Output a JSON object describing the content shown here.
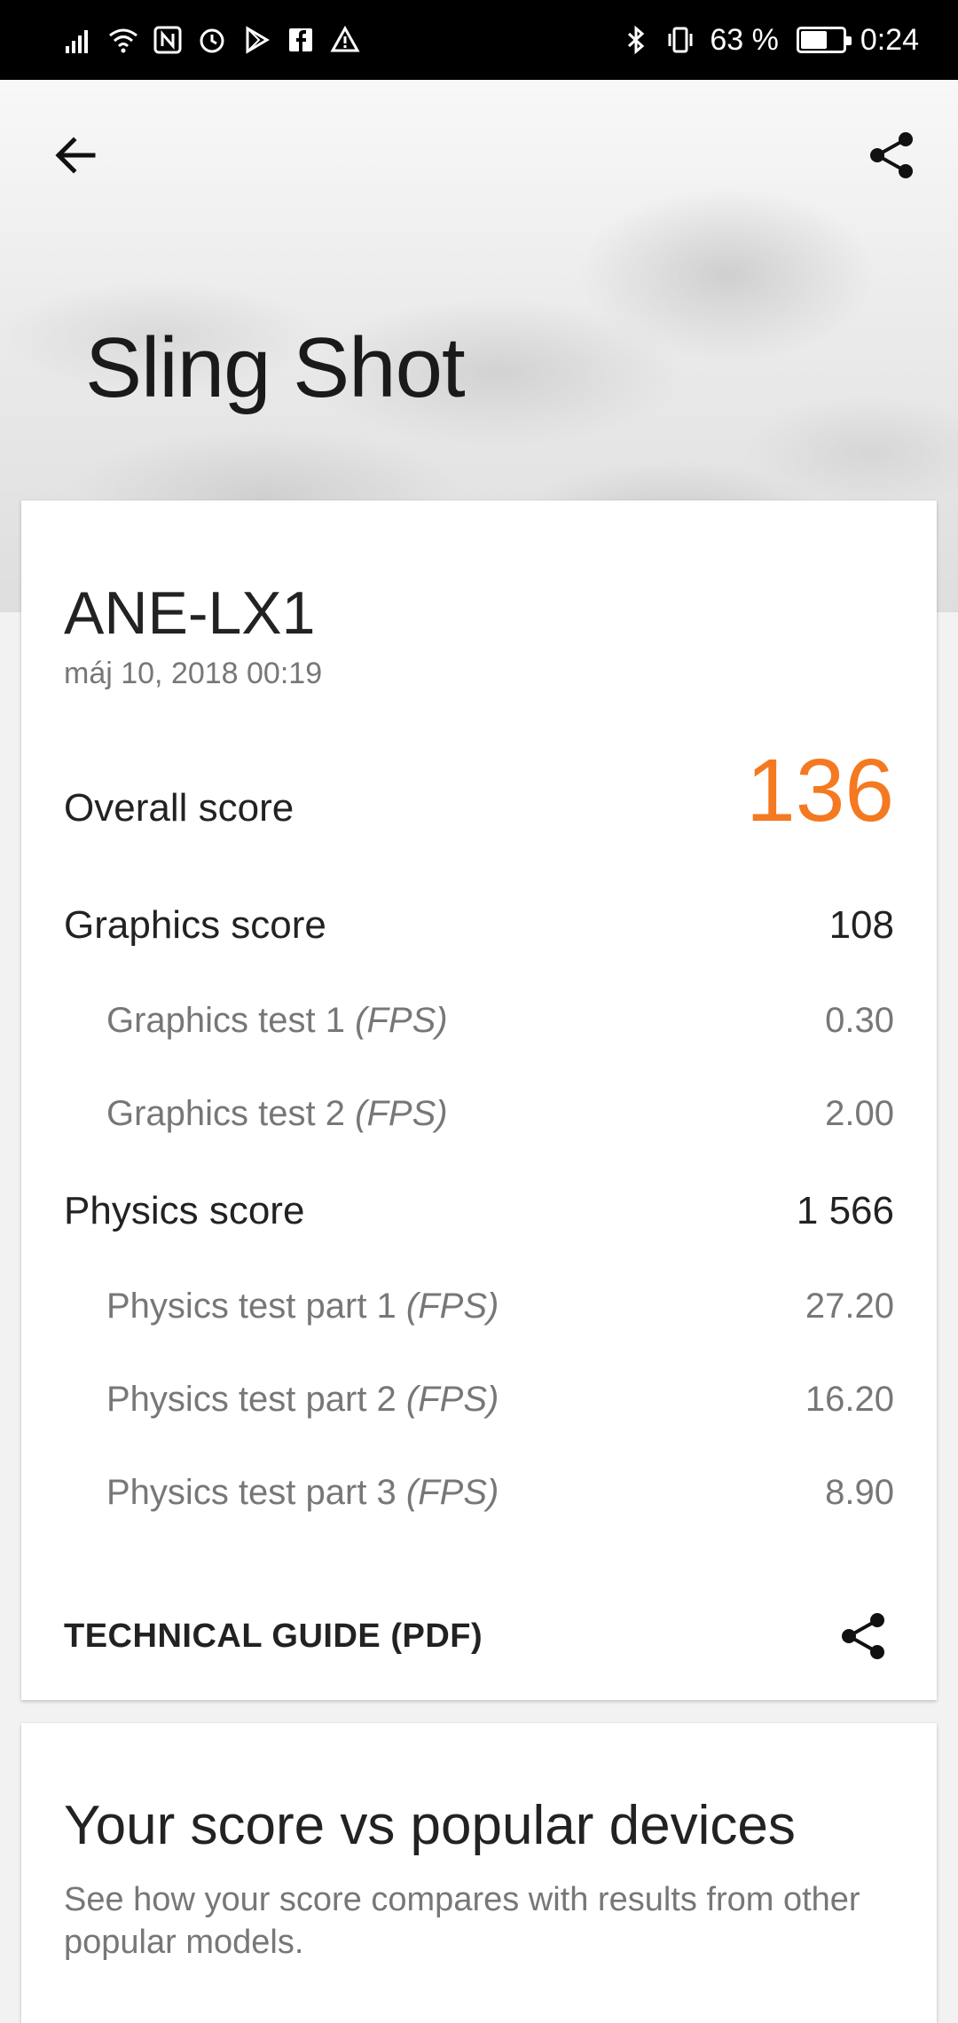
{
  "status_bar": {
    "battery_percent_text": "63 %",
    "battery_level": 0.63,
    "time": "0:24",
    "icons_left": [
      "signal-icon",
      "wifi-icon",
      "nfc-icon",
      "alarm-icon",
      "play-store-icon",
      "facebook-icon",
      "warning-icon"
    ],
    "icons_right": [
      "bluetooth-icon",
      "vibrate-icon",
      "battery-icon"
    ]
  },
  "header": {
    "title": "Sling Shot",
    "back_icon": "arrow-left-icon",
    "share_icon": "share-icon"
  },
  "result": {
    "device_name": "ANE-LX1",
    "date": "máj 10, 2018 00:19",
    "overall": {
      "label": "Overall score",
      "value": "136"
    },
    "graphics": {
      "label": "Graphics score",
      "value": "108",
      "tests": [
        {
          "label": "Graphics test 1",
          "unit": "(FPS)",
          "value": "0.30"
        },
        {
          "label": "Graphics test 2",
          "unit": "(FPS)",
          "value": "2.00"
        }
      ]
    },
    "physics": {
      "label": "Physics score",
      "value": "1 566",
      "tests": [
        {
          "label": "Physics test part 1",
          "unit": "(FPS)",
          "value": "27.20"
        },
        {
          "label": "Physics test part 2",
          "unit": "(FPS)",
          "value": "16.20"
        },
        {
          "label": "Physics test part 3",
          "unit": "(FPS)",
          "value": "8.90"
        }
      ]
    },
    "technical_guide_label": "TECHNICAL GUIDE (PDF)"
  },
  "comparison": {
    "title": "Your score vs popular devices",
    "description": "See how your score compares with results from other popular models."
  },
  "colors": {
    "accent": "#f47920",
    "text_primary": "#222222",
    "text_secondary": "#777777"
  }
}
